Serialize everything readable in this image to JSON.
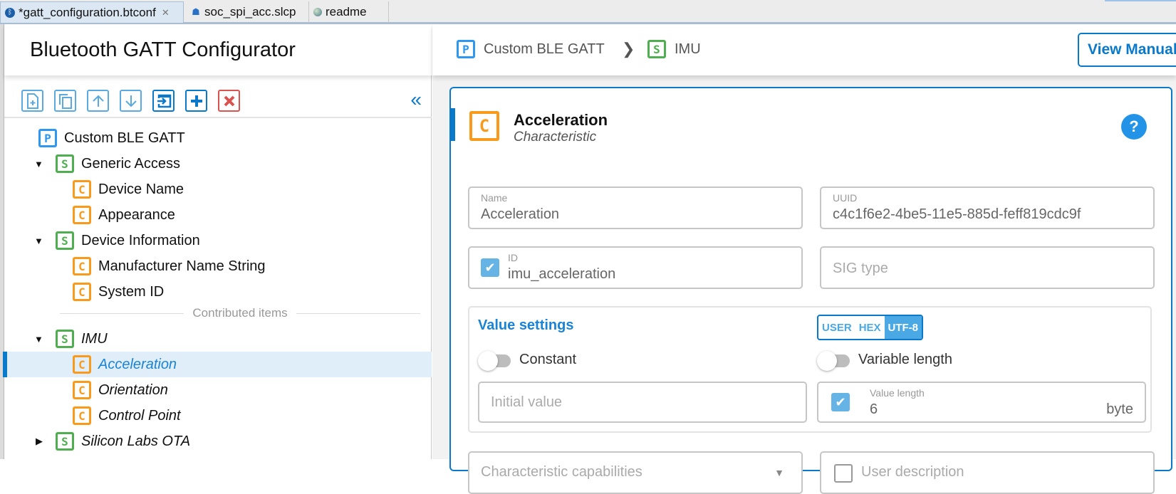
{
  "tabs": [
    {
      "label": "*gatt_configuration.btconf",
      "icon": "bluetooth-icon",
      "active": true,
      "close": "✕"
    },
    {
      "label": "soc_spi_acc.slcp",
      "icon": "project-icon",
      "active": false
    },
    {
      "label": "readme",
      "icon": "globe-icon",
      "active": false
    }
  ],
  "sidebar": {
    "title": "Bluetooth GATT Configurator",
    "toolbar": [
      {
        "name": "add-file-button",
        "icon": "add-file-icon"
      },
      {
        "name": "duplicate-button",
        "icon": "copy-icon"
      },
      {
        "name": "move-up-button",
        "icon": "arrow-up-icon"
      },
      {
        "name": "move-down-button",
        "icon": "arrow-down-icon"
      },
      {
        "name": "import-button",
        "icon": "import-icon"
      },
      {
        "name": "add-button",
        "icon": "plus-icon"
      },
      {
        "name": "delete-button",
        "icon": "delete-icon"
      }
    ],
    "collapse_glyph": "«",
    "divider_label": "Contributed items",
    "tree": [
      {
        "badge": "P",
        "label": "Custom BLE GATT",
        "level": 0,
        "caret": ""
      },
      {
        "badge": "S",
        "label": "Generic Access",
        "level": 1,
        "caret": "▼"
      },
      {
        "badge": "C",
        "label": "Device Name",
        "level": 2,
        "caret": ""
      },
      {
        "badge": "C",
        "label": "Appearance",
        "level": 2,
        "caret": ""
      },
      {
        "badge": "S",
        "label": "Device Information",
        "level": 1,
        "caret": "▼"
      },
      {
        "badge": "C",
        "label": "Manufacturer Name String",
        "level": 2,
        "caret": ""
      },
      {
        "badge": "C",
        "label": "System ID",
        "level": 2,
        "caret": ""
      },
      {
        "badge": "S",
        "label": "IMU",
        "level": 1,
        "caret": "▼",
        "italic": true
      },
      {
        "badge": "C",
        "label": "Acceleration",
        "level": 2,
        "caret": "",
        "italic": true,
        "selected": true
      },
      {
        "badge": "C",
        "label": "Orientation",
        "level": 2,
        "caret": "",
        "italic": true
      },
      {
        "badge": "C",
        "label": "Control Point",
        "level": 2,
        "caret": "",
        "italic": true
      },
      {
        "badge": "S",
        "label": "Silicon Labs OTA",
        "level": 1,
        "caret": "▶",
        "italic": true
      }
    ]
  },
  "breadcrumb": [
    {
      "badge": "P",
      "label": "Custom BLE GATT"
    },
    {
      "badge": "S",
      "label": "IMU"
    }
  ],
  "breadcrumb_sep": "❯",
  "view_manual_label": "View Manual",
  "card": {
    "badge": "C",
    "title": "Acceleration",
    "subtitle": "Characteristic",
    "help": "?",
    "name_label": "Name",
    "name_value": "Acceleration",
    "uuid_label": "UUID",
    "uuid_value": "c4c1f6e2-4be5-11e5-885d-feff819cdc9f",
    "id_label": "ID",
    "id_value": "imu_acceleration",
    "id_checked": true,
    "sig_placeholder": "SIG type",
    "value_settings": {
      "title": "Value settings",
      "formats": [
        "USER",
        "HEX",
        "UTF-8"
      ],
      "selected_format": "UTF-8",
      "constant_label": "Constant",
      "constant_on": false,
      "variable_length_label": "Variable length",
      "variable_length_on": false,
      "initial_value_placeholder": "Initial value",
      "value_length_label": "Value length",
      "value_length": "6",
      "value_length_unit": "byte",
      "value_length_checked": true
    },
    "capabilities_placeholder": "Characteristic capabilities",
    "user_description_label": "User description",
    "user_description_checked": false
  },
  "colors": {
    "accent": "#0a79c9",
    "profile": "#2e98f0",
    "service": "#4fae4f",
    "characteristic": "#f89b1c",
    "delete": "#d9534f"
  }
}
